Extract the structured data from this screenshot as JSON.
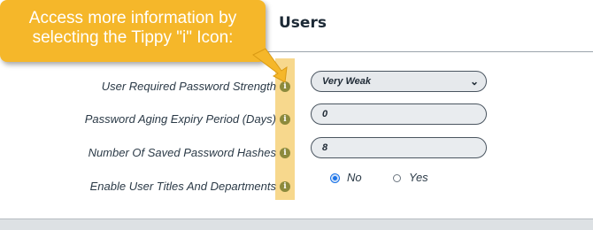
{
  "header": {
    "title": "Users"
  },
  "callout": {
    "text": "Access more information by\nselecting the Tippy \"i\" Icon:"
  },
  "fields": [
    {
      "label": "User Required Password Strength",
      "value": "Very Weak"
    },
    {
      "label": "Password Aging Expiry Period (Days)",
      "value": "0"
    },
    {
      "label": "Number Of Saved Password Hashes",
      "value": "8"
    },
    {
      "label": "Enable User Titles And Departments",
      "options": [
        "No",
        "Yes"
      ],
      "selected": "No"
    }
  ],
  "icons": {
    "info": "i",
    "chevron": "⌄"
  },
  "colors": {
    "callout": "#f5b72a",
    "highlight": "#f7d88d",
    "radio_selected": "#1a73e8"
  }
}
